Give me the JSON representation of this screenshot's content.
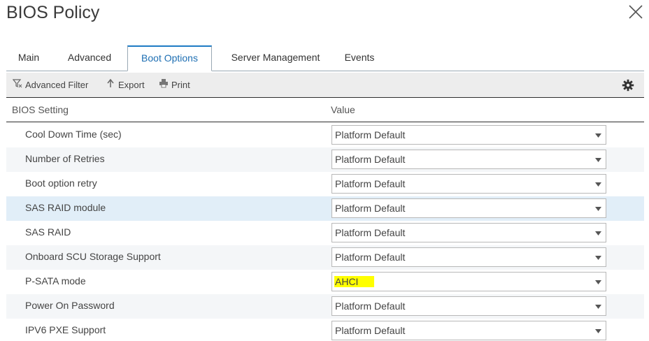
{
  "dialog": {
    "title": "BIOS Policy"
  },
  "tabs": [
    {
      "label": "Main"
    },
    {
      "label": "Advanced"
    },
    {
      "label": "Boot Options"
    },
    {
      "label": "Server Management"
    },
    {
      "label": "Events"
    }
  ],
  "active_tab": "Boot Options",
  "toolbar": {
    "filter_label": "Advanced Filter",
    "export_label": "Export",
    "print_label": "Print",
    "icons": [
      "filter-icon",
      "export-arrow-icon",
      "printer-icon",
      "gear-icon"
    ]
  },
  "table": {
    "columns": [
      "BIOS Setting",
      "Value"
    ],
    "rows": [
      {
        "setting": "Cool Down Time (sec)",
        "value": "Platform Default"
      },
      {
        "setting": "Number of Retries",
        "value": "Platform Default"
      },
      {
        "setting": "Boot option retry",
        "value": "Platform Default"
      },
      {
        "setting": "SAS RAID module",
        "value": "Platform Default"
      },
      {
        "setting": "SAS RAID",
        "value": "Platform Default"
      },
      {
        "setting": "Onboard SCU Storage Support",
        "value": "Platform Default"
      },
      {
        "setting": "P-SATA mode",
        "value": "AHCI"
      },
      {
        "setting": "Power On Password",
        "value": "Platform Default"
      },
      {
        "setting": "IPV6 PXE Support",
        "value": "Platform Default"
      }
    ]
  },
  "colors": {
    "accent": "#1e7bc4",
    "highlight_row": "#e1eef8",
    "value_highlight": "#ffff00"
  }
}
